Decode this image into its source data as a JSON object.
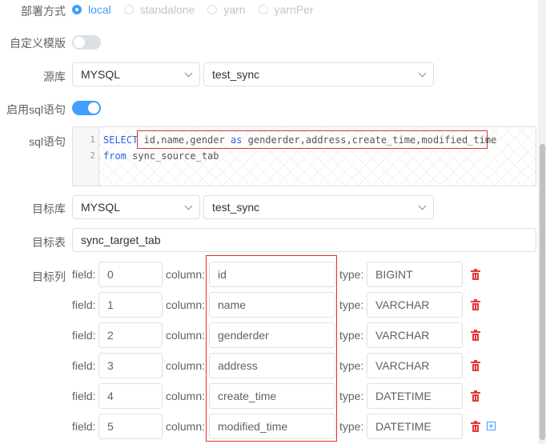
{
  "deploy": {
    "label": "部署方式",
    "options": [
      {
        "label": "local",
        "selected": true
      },
      {
        "label": "standalone",
        "selected": false
      },
      {
        "label": "yarn",
        "selected": false
      },
      {
        "label": "yarnPer",
        "selected": false
      }
    ]
  },
  "custom_template": {
    "label": "自定义模版",
    "enabled": false
  },
  "source": {
    "label": "源库",
    "db_type": "MYSQL",
    "db_name": "test_sync"
  },
  "enable_sql": {
    "label": "启用sql语句",
    "enabled": true
  },
  "sql": {
    "label": "sql语句",
    "lines": [
      {
        "no": "1",
        "keyword": "SELECT",
        "rest_a": " id,name,gender ",
        "kw2": "as",
        "rest_b": " genderder,address,create_time,modified_time"
      },
      {
        "no": "2",
        "keyword": "from",
        "rest_a": " sync_source_tab",
        "kw2": "",
        "rest_b": ""
      }
    ]
  },
  "target": {
    "label": "目标库",
    "db_type": "MYSQL",
    "db_name": "test_sync"
  },
  "target_table": {
    "label": "目标表",
    "value": "sync_target_tab"
  },
  "target_columns": {
    "label": "目标列",
    "field_label": "field:",
    "column_label": "column:",
    "type_label": "type:",
    "rows": [
      {
        "field": "0",
        "column": "id",
        "type": "BIGINT"
      },
      {
        "field": "1",
        "column": "name",
        "type": "VARCHAR"
      },
      {
        "field": "2",
        "column": "genderder",
        "type": "VARCHAR"
      },
      {
        "field": "3",
        "column": "address",
        "type": "VARCHAR"
      },
      {
        "field": "4",
        "column": "create_time",
        "type": "DATETIME"
      },
      {
        "field": "5",
        "column": "modified_time",
        "type": "DATETIME"
      }
    ]
  },
  "colors": {
    "accent": "#409eff",
    "danger": "#e53935",
    "highlight": "#e0302f"
  }
}
